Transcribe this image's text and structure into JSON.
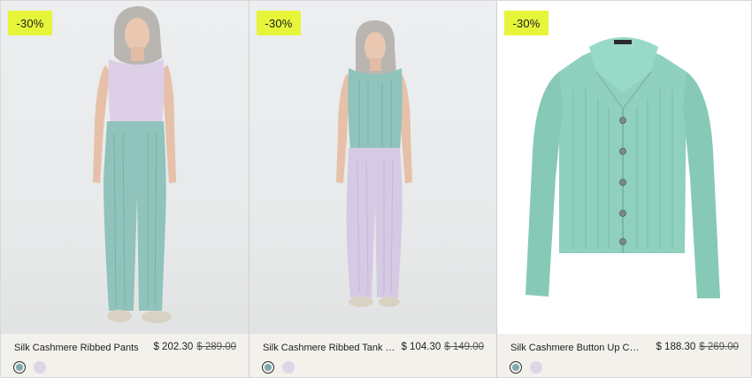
{
  "products": [
    {
      "discount_badge": "-30%",
      "name": "Silk Cashmere Ribbed Pants",
      "price": "$ 202.30",
      "old_price": "$ 289.00",
      "swatches": [
        "teal",
        "lilac"
      ]
    },
    {
      "discount_badge": "-30%",
      "name": "Silk Cashmere Ribbed Tank Top",
      "price": "$ 104.30",
      "old_price": "$ 149.00",
      "swatches": [
        "teal",
        "lilac"
      ]
    },
    {
      "discount_badge": "-30%",
      "name": "Silk Cashmere Button Up Cardig...",
      "price": "$ 188.30",
      "old_price": "$ 269.00",
      "swatches": [
        "teal",
        "lilac"
      ]
    }
  ],
  "colors": {
    "badge": "#e6f53a",
    "teal": "#7fa9ad",
    "lilac": "#ddd6e6",
    "info_bg": "#f3f1ec"
  }
}
